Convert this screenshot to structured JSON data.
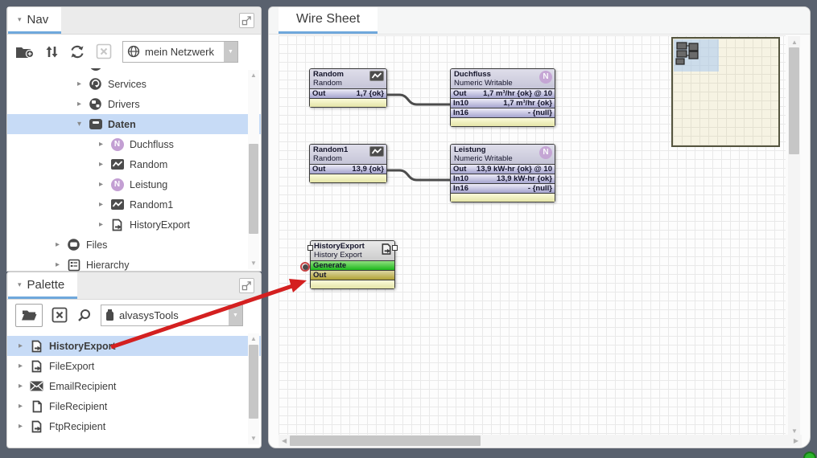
{
  "icons": {
    "tab_caret": "▾",
    "dropdown_arrow": "▼",
    "scroll_up": "▲",
    "scroll_down": "▼",
    "scroll_left": "◀",
    "scroll_right": "▶"
  },
  "colors": {
    "accent_blue": "#6fa8dc",
    "selection_blue": "#c7dbf6",
    "frame_gray": "#59616e",
    "arrow_red": "#d42020",
    "generate_green": "#2fbf2f",
    "status_green": "#2db52d",
    "wire_gray": "#4c4c4c"
  },
  "nav": {
    "title": "Nav",
    "network_dropdown": "mein Netzwerk",
    "tree": [
      {
        "arrow": "▸",
        "label": "Services"
      },
      {
        "arrow": "▸",
        "label": "Drivers"
      },
      {
        "arrow": "▾",
        "label": "Daten"
      },
      {
        "arrow": "▸",
        "label": "Duchfluss"
      },
      {
        "arrow": "▸",
        "label": "Random"
      },
      {
        "arrow": "▸",
        "label": "Leistung"
      },
      {
        "arrow": "▸",
        "label": "Random1"
      },
      {
        "arrow": "▸",
        "label": "HistoryExport"
      },
      {
        "arrow": "▸",
        "label": "Files"
      },
      {
        "arrow": "▸",
        "label": "Hierarchy"
      }
    ]
  },
  "palette": {
    "title": "Palette",
    "library_dropdown": "alvasysTools",
    "items": [
      {
        "arrow": "▸",
        "label": "HistoryExport"
      },
      {
        "arrow": "▸",
        "label": "FileExport"
      },
      {
        "arrow": "▸",
        "label": "EmailRecipient"
      },
      {
        "arrow": "▸",
        "label": "FileRecipient"
      },
      {
        "arrow": "▸",
        "label": "FtpRecipient"
      }
    ]
  },
  "wiresheet": {
    "tab_label": "Wire Sheet",
    "blocks": {
      "random": {
        "title": "Random",
        "subtitle": "Random",
        "rows": [
          {
            "label": "Out",
            "value": "1,7 {ok}"
          }
        ]
      },
      "duchfluss": {
        "title": "Duchfluss",
        "subtitle": "Numeric Writable",
        "badge": "N",
        "rows": [
          {
            "label": "Out",
            "value": "1,7 m³/hr {ok} @ 10"
          },
          {
            "label": "In10",
            "value": "1,7 m³/hr {ok}"
          },
          {
            "label": "In16",
            "value": "- {null}"
          }
        ]
      },
      "random1": {
        "title": "Random1",
        "subtitle": "Random",
        "rows": [
          {
            "label": "Out",
            "value": "13,9 {ok}"
          }
        ]
      },
      "leistung": {
        "title": "Leistung",
        "subtitle": "Numeric Writable",
        "badge": "N",
        "rows": [
          {
            "label": "Out",
            "value": "13,9 kW-hr {ok} @ 10"
          },
          {
            "label": "In10",
            "value": "13,9 kW-hr {ok}"
          },
          {
            "label": "In16",
            "value": "- {null}"
          }
        ]
      },
      "historyexport": {
        "title": "HistoryExport",
        "subtitle": "History Export",
        "rows": [
          {
            "label": "Generate",
            "value": ""
          },
          {
            "label": "Out",
            "value": ""
          }
        ]
      }
    }
  }
}
